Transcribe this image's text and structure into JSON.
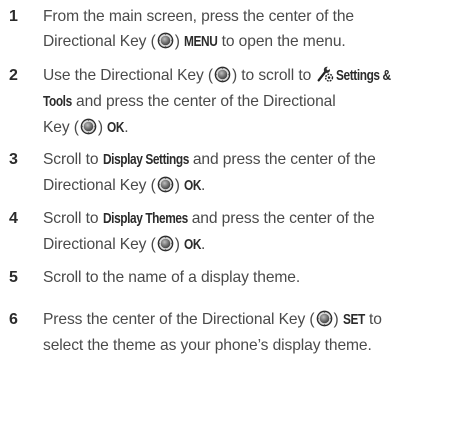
{
  "steps": [
    {
      "number": "1",
      "lines": [
        [
          "From the main screen, press the center of the"
        ],
        [
          "Directional Key (",
          "KEY",
          ") ",
          "[MENU]",
          " to open the menu."
        ]
      ]
    },
    {
      "number": "2",
      "lines": [
        [
          "Use the Directional Key (",
          "KEY",
          ") to scroll to ",
          "TOOLS",
          "[Settings &]"
        ],
        [
          "[Tools]",
          " and press the center of the Directional"
        ],
        [
          "Key (",
          "KEY",
          ") ",
          "[OK]",
          "."
        ]
      ]
    },
    {
      "number": "3",
      "lines": [
        [
          "Scroll to ",
          "[Display Settings]",
          " and press the center of the"
        ],
        [
          "Directional Key (",
          "KEY",
          ") ",
          "[OK]",
          "."
        ]
      ]
    },
    {
      "number": "4",
      "lines": [
        [
          "Scroll to ",
          "[Display Themes]",
          " and press the center of the"
        ],
        [
          "Directional Key (",
          "KEY",
          ") ",
          "[OK]",
          "."
        ]
      ]
    },
    {
      "number": "5",
      "lines": [
        [
          "Scroll to the name of a display theme."
        ]
      ]
    },
    {
      "number": "6",
      "lines": [
        [
          "Press the center of the Directional Key (",
          "KEY",
          ") ",
          "[SET]",
          " to"
        ],
        [
          "select the theme as your phone’s display theme."
        ]
      ]
    }
  ],
  "text_color": "#4a4a4a",
  "number_color": "#2b2b2b",
  "icons": {
    "directional_key": "directional-key-icon",
    "settings_tools": "settings-tools-icon"
  }
}
